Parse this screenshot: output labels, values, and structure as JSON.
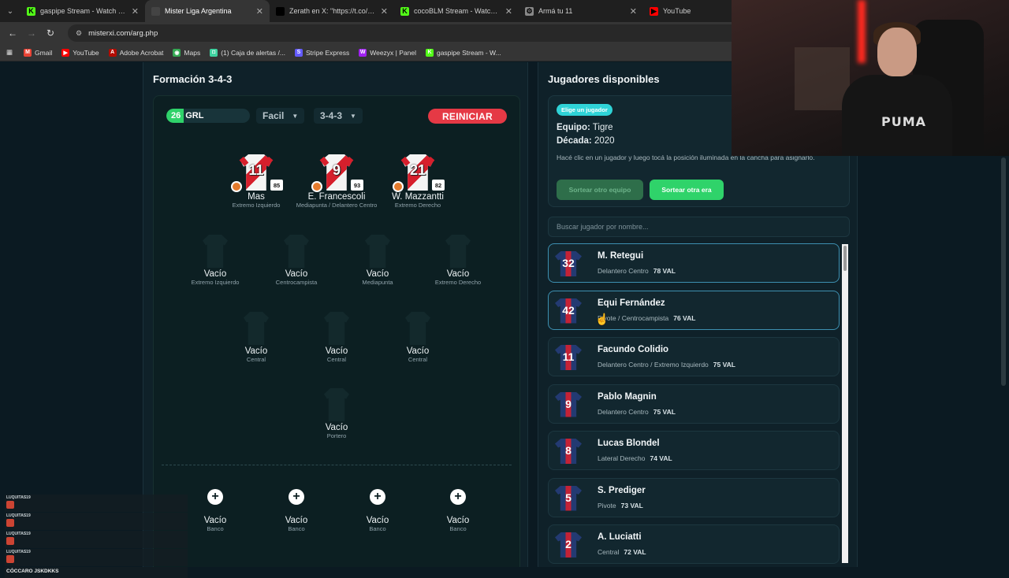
{
  "browser": {
    "tabs": [
      {
        "title": "gaspipe Stream - Watch Live on",
        "fav_color": "#53fc18",
        "fav_glyph": "K"
      },
      {
        "title": "Mister Liga Argentina",
        "fav_color": "#444",
        "fav_glyph": ""
      },
      {
        "title": "Zerath en X: \"https://t.co/4VGFi",
        "fav_color": "#000",
        "fav_glyph": "X"
      },
      {
        "title": "cocoBLM Stream - Watch Live o",
        "fav_color": "#53fc18",
        "fav_glyph": "K"
      },
      {
        "title": "Armá tu 11",
        "fav_color": "#888",
        "fav_glyph": "⚙"
      },
      {
        "title": "YouTube",
        "fav_color": "#ff0000",
        "fav_glyph": "▶"
      }
    ],
    "url": "misterxi.com/arg.php",
    "bookmarks": [
      {
        "label": "Gmail",
        "color": "#ea4335",
        "glyph": "M"
      },
      {
        "label": "YouTube",
        "color": "#ff0000",
        "glyph": "▶"
      },
      {
        "label": "Adobe Acrobat",
        "color": "#b30b00",
        "glyph": "A"
      },
      {
        "label": "Maps",
        "color": "#34a853",
        "glyph": "◉"
      },
      {
        "label": "(1) Caja de alertas /...",
        "color": "#3fd3a0",
        "glyph": "◘"
      },
      {
        "label": "Stripe Express",
        "color": "#635bff",
        "glyph": "S"
      },
      {
        "label": "Weezyx | Panel",
        "color": "#a020f0",
        "glyph": "W"
      },
      {
        "label": "gaspipe Stream - W...",
        "color": "#53fc18",
        "glyph": "K"
      }
    ]
  },
  "formation": {
    "title": "Formación 3-4-3",
    "grl_value": "26",
    "grl_label": "GRL",
    "difficulty": "Facil",
    "scheme": "3-4-3",
    "reset_label": "REINICIAR",
    "forwards": [
      {
        "number": "11",
        "rating": "85",
        "name": "Mas",
        "position": "Extremo Izquierdo"
      },
      {
        "number": "9",
        "rating": "93",
        "name": "E. Francescoli",
        "position": "Mediapunta / Delantero Centro"
      },
      {
        "number": "21",
        "rating": "82",
        "name": "W. Mazzantti",
        "position": "Extremo Derecho"
      }
    ],
    "midfielders": [
      {
        "name": "Vacío",
        "position": "Extremo Izquierdo"
      },
      {
        "name": "Vacío",
        "position": "Centrocampista"
      },
      {
        "name": "Vacío",
        "position": "Mediapunta"
      },
      {
        "name": "Vacío",
        "position": "Extremo Derecho"
      }
    ],
    "defenders": [
      {
        "name": "Vacío",
        "position": "Central"
      },
      {
        "name": "Vacío",
        "position": "Central"
      },
      {
        "name": "Vacío",
        "position": "Central"
      }
    ],
    "goalkeeper": {
      "name": "Vacío",
      "position": "Portero"
    },
    "bench": [
      {
        "name": "Vacío",
        "position": "Banco"
      },
      {
        "name": "Vacío",
        "position": "Banco"
      },
      {
        "name": "Vacío",
        "position": "Banco"
      },
      {
        "name": "Vacío",
        "position": "Banco"
      }
    ]
  },
  "available": {
    "title": "Jugadores disponibles",
    "pill": "Elige un jugador",
    "team_label": "Equipo:",
    "team_value": "Tigre",
    "decade_label": "Década:",
    "decade_value": "2020",
    "hint": "Hacé clic en un jugador y luego tocá la posición iluminada en la cancha para asignarlo.",
    "btn_other_team": "Sortear otro equipo",
    "btn_other_era": "Sortear otra era",
    "search_placeholder": "Buscar jugador por nombre...",
    "players": [
      {
        "number": "32",
        "name": "M. Retegui",
        "position": "Delantero Centro",
        "val": "78 VAL"
      },
      {
        "number": "42",
        "name": "Equi Fernández",
        "position": "Pivote / Centrocampista",
        "val": "76 VAL"
      },
      {
        "number": "11",
        "name": "Facundo Colidio",
        "position": "Delantero Centro / Extremo Izquierdo",
        "val": "75 VAL"
      },
      {
        "number": "9",
        "name": "Pablo Magnin",
        "position": "Delantero Centro",
        "val": "75 VAL"
      },
      {
        "number": "8",
        "name": "Lucas Blondel",
        "position": "Lateral Derecho",
        "val": "74 VAL"
      },
      {
        "number": "5",
        "name": "S. Prediger",
        "position": "Pivote",
        "val": "73 VAL"
      },
      {
        "number": "2",
        "name": "A. Luciatti",
        "position": "Central",
        "val": "72 VAL"
      }
    ]
  },
  "webcam": {
    "shirt_logo": "PUMA"
  },
  "chat": {
    "users": [
      "LUQUITAS19",
      "LUQUITAS19",
      "LUQUITAS19",
      "LUQUITAS19"
    ],
    "last_message": "CÓCCARO JSKDKKS"
  },
  "colors": {
    "accent_green": "#2fd36a",
    "reset_red": "#e53945",
    "pill_cyan": "#2fd3d7"
  }
}
